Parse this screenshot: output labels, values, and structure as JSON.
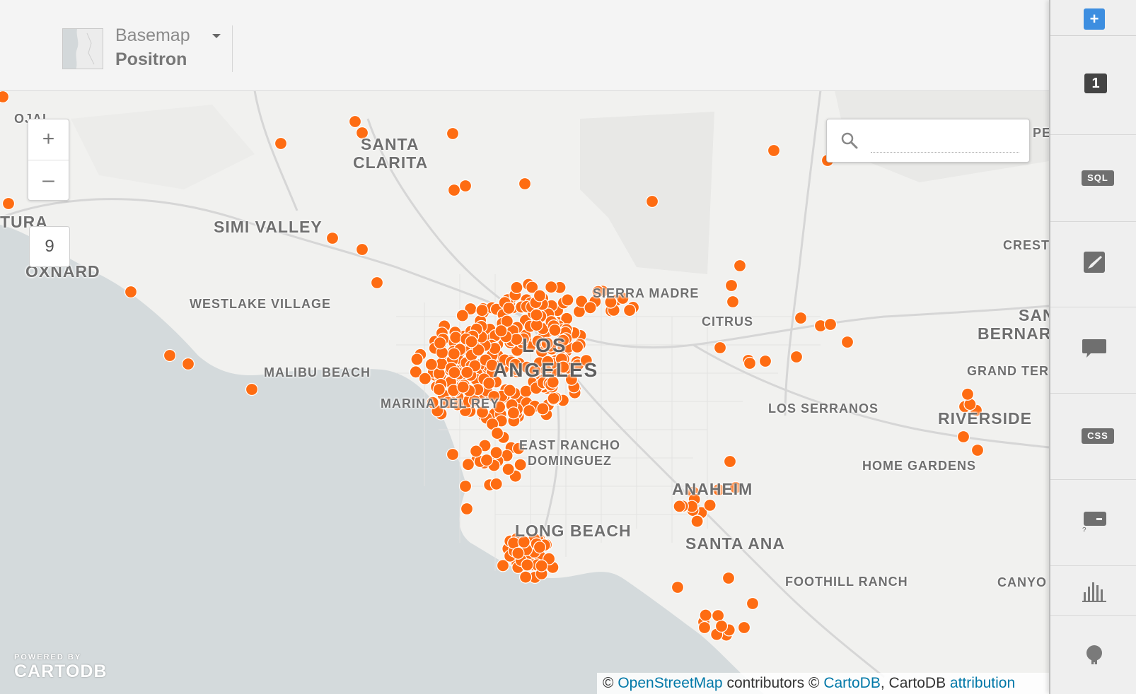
{
  "toolbar": {
    "basemap_label": "Basemap",
    "basemap_value": "Positron"
  },
  "map": {
    "zoom_in": "+",
    "zoom_out": "–",
    "zoom_level": "9",
    "search": {
      "value": "",
      "placeholder": ""
    },
    "place_labels": {
      "santa": "SANTA",
      "clarita": "CLARITA",
      "simi_valley": "SIMI VALLEY",
      "oxnard": "OXNARD",
      "tura": "TURA",
      "ojai": "OJAI",
      "westlake": "WESTLAKE VILLAGE",
      "malibu": "MALIBU BEACH",
      "los": "LOS",
      "angeles": "ANGELES",
      "sierra_madre": "SIERRA MADRE",
      "citrus": "CITRUS",
      "marina": "MARINA DEL REY",
      "east_rancho": "EAST RANCHO",
      "dominguez": "DOMINGUEZ",
      "long_beach": "LONG BEACH",
      "anaheim": "ANAHEIM",
      "santa_ana": "SANTA ANA",
      "los_serranos": "LOS SERRANOS",
      "riverside": "RIVERSIDE",
      "home_gardens": "HOME GARDENS",
      "foothill_ranch": "FOOTHILL RANCH",
      "crest": "CRESTI",
      "san": "SAN",
      "bernar": "BERNAR",
      "grand_terr": "GRAND TERR",
      "canyo": "CANYO",
      "per": "PER"
    },
    "logo_powered": "POWERED BY",
    "logo_brand": "CARTODB",
    "attribution": {
      "c1": "©",
      "osm": "OpenStreetMap",
      "contrib": "contributors",
      "c2": "©",
      "cartodb": "CartoDB",
      "sep": ",",
      "cartodb2": "CartoDB",
      "attribution": "attribution"
    }
  },
  "panel": {
    "add": "+",
    "layer_number": "1",
    "sql": "SQL",
    "css": "CSS"
  },
  "colors": {
    "marker": "#fe6c12",
    "water": "#d4dadc",
    "land": "#f1f1ef",
    "accent": "#3d8ee0"
  }
}
